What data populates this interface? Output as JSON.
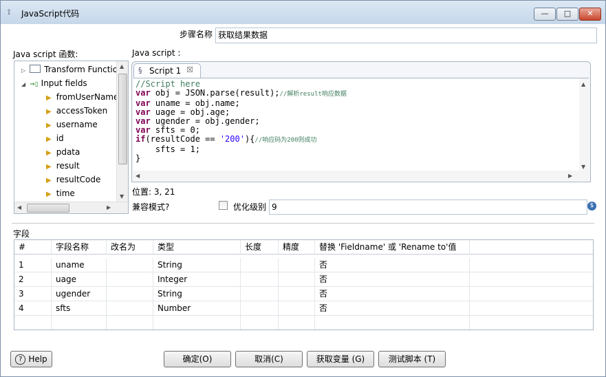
{
  "window": {
    "title": "JavaScript代码",
    "min_glyph": "—",
    "max_glyph": "□",
    "close_glyph": "✕"
  },
  "step": {
    "label": "步骤名称",
    "value": "获取结果数据"
  },
  "functions_label": "Java script 函数:",
  "script_label": "Java script :",
  "tree": [
    {
      "label": "Transform Functio",
      "expand": "▷",
      "icon": "folder-icon"
    },
    {
      "label": "Input fields",
      "expand": "◢",
      "icon": "input-fields-icon"
    },
    {
      "label": "fromUserName",
      "icon": "field-arrow-icon"
    },
    {
      "label": "accessToken",
      "icon": "field-arrow-icon"
    },
    {
      "label": "username",
      "icon": "field-arrow-icon"
    },
    {
      "label": "id",
      "icon": "field-arrow-icon"
    },
    {
      "label": "pdata",
      "icon": "field-arrow-icon"
    },
    {
      "label": "result",
      "icon": "field-arrow-icon"
    },
    {
      "label": "resultCode",
      "icon": "field-arrow-icon"
    },
    {
      "label": "time",
      "icon": "field-arrow-icon"
    }
  ],
  "tab": {
    "label": "Script 1",
    "close": "☒"
  },
  "code_lines": [
    [
      {
        "t": "//Script here",
        "c": "cm"
      }
    ],
    [
      {
        "t": "var",
        "c": "kw"
      },
      {
        "t": " obj = JSON.parse(result);"
      },
      {
        "t": "//解析result响应数据",
        "c": "cm",
        "small": true
      }
    ],
    [
      {
        "t": "var",
        "c": "kw"
      },
      {
        "t": " uname = obj.name;"
      }
    ],
    [
      {
        "t": "var",
        "c": "kw"
      },
      {
        "t": " uage = obj.age;"
      }
    ],
    [
      {
        "t": "var",
        "c": "kw"
      },
      {
        "t": " ugender = obj.gender;"
      }
    ],
    [
      {
        "t": "var",
        "c": "kw"
      },
      {
        "t": " sfts = 0;"
      }
    ],
    [
      {
        "t": "if",
        "c": "kw"
      },
      {
        "t": "(resultCode == "
      },
      {
        "t": "'200'",
        "c": "str"
      },
      {
        "t": "){"
      },
      {
        "t": "//响应码为200则成功",
        "c": "cm",
        "small": true
      }
    ],
    [
      {
        "t": "    sfts = 1;"
      }
    ],
    [
      {
        "t": "}"
      }
    ]
  ],
  "position": "位置: 3, 21",
  "compat_label": "兼容模式?",
  "opt_label": "优化级别",
  "opt_value": "9",
  "fields_label": "字段",
  "table": {
    "headers": [
      "#",
      "字段名称",
      "改名为",
      "类型",
      "长度",
      "精度",
      "替换 'Fieldname' 或 'Rename to'值"
    ],
    "rows": [
      [
        "1",
        "uname",
        "",
        "String",
        "",
        "",
        "否"
      ],
      [
        "2",
        "uage",
        "",
        "Integer",
        "",
        "",
        "否"
      ],
      [
        "3",
        "ugender",
        "",
        "String",
        "",
        "",
        "否"
      ],
      [
        "4",
        "sfts",
        "",
        "Number",
        "",
        "",
        "否"
      ]
    ]
  },
  "buttons": {
    "help": "Help",
    "ok": "确定(O)",
    "cancel": "取消(C)",
    "get_vars": "获取变量 (G)",
    "test": "测试脚本 (T)"
  },
  "colors": {
    "keyword": "#7f0055",
    "comment": "#3f7f5f",
    "string": "#2a00ff",
    "field_arrow": "#d4a017"
  }
}
